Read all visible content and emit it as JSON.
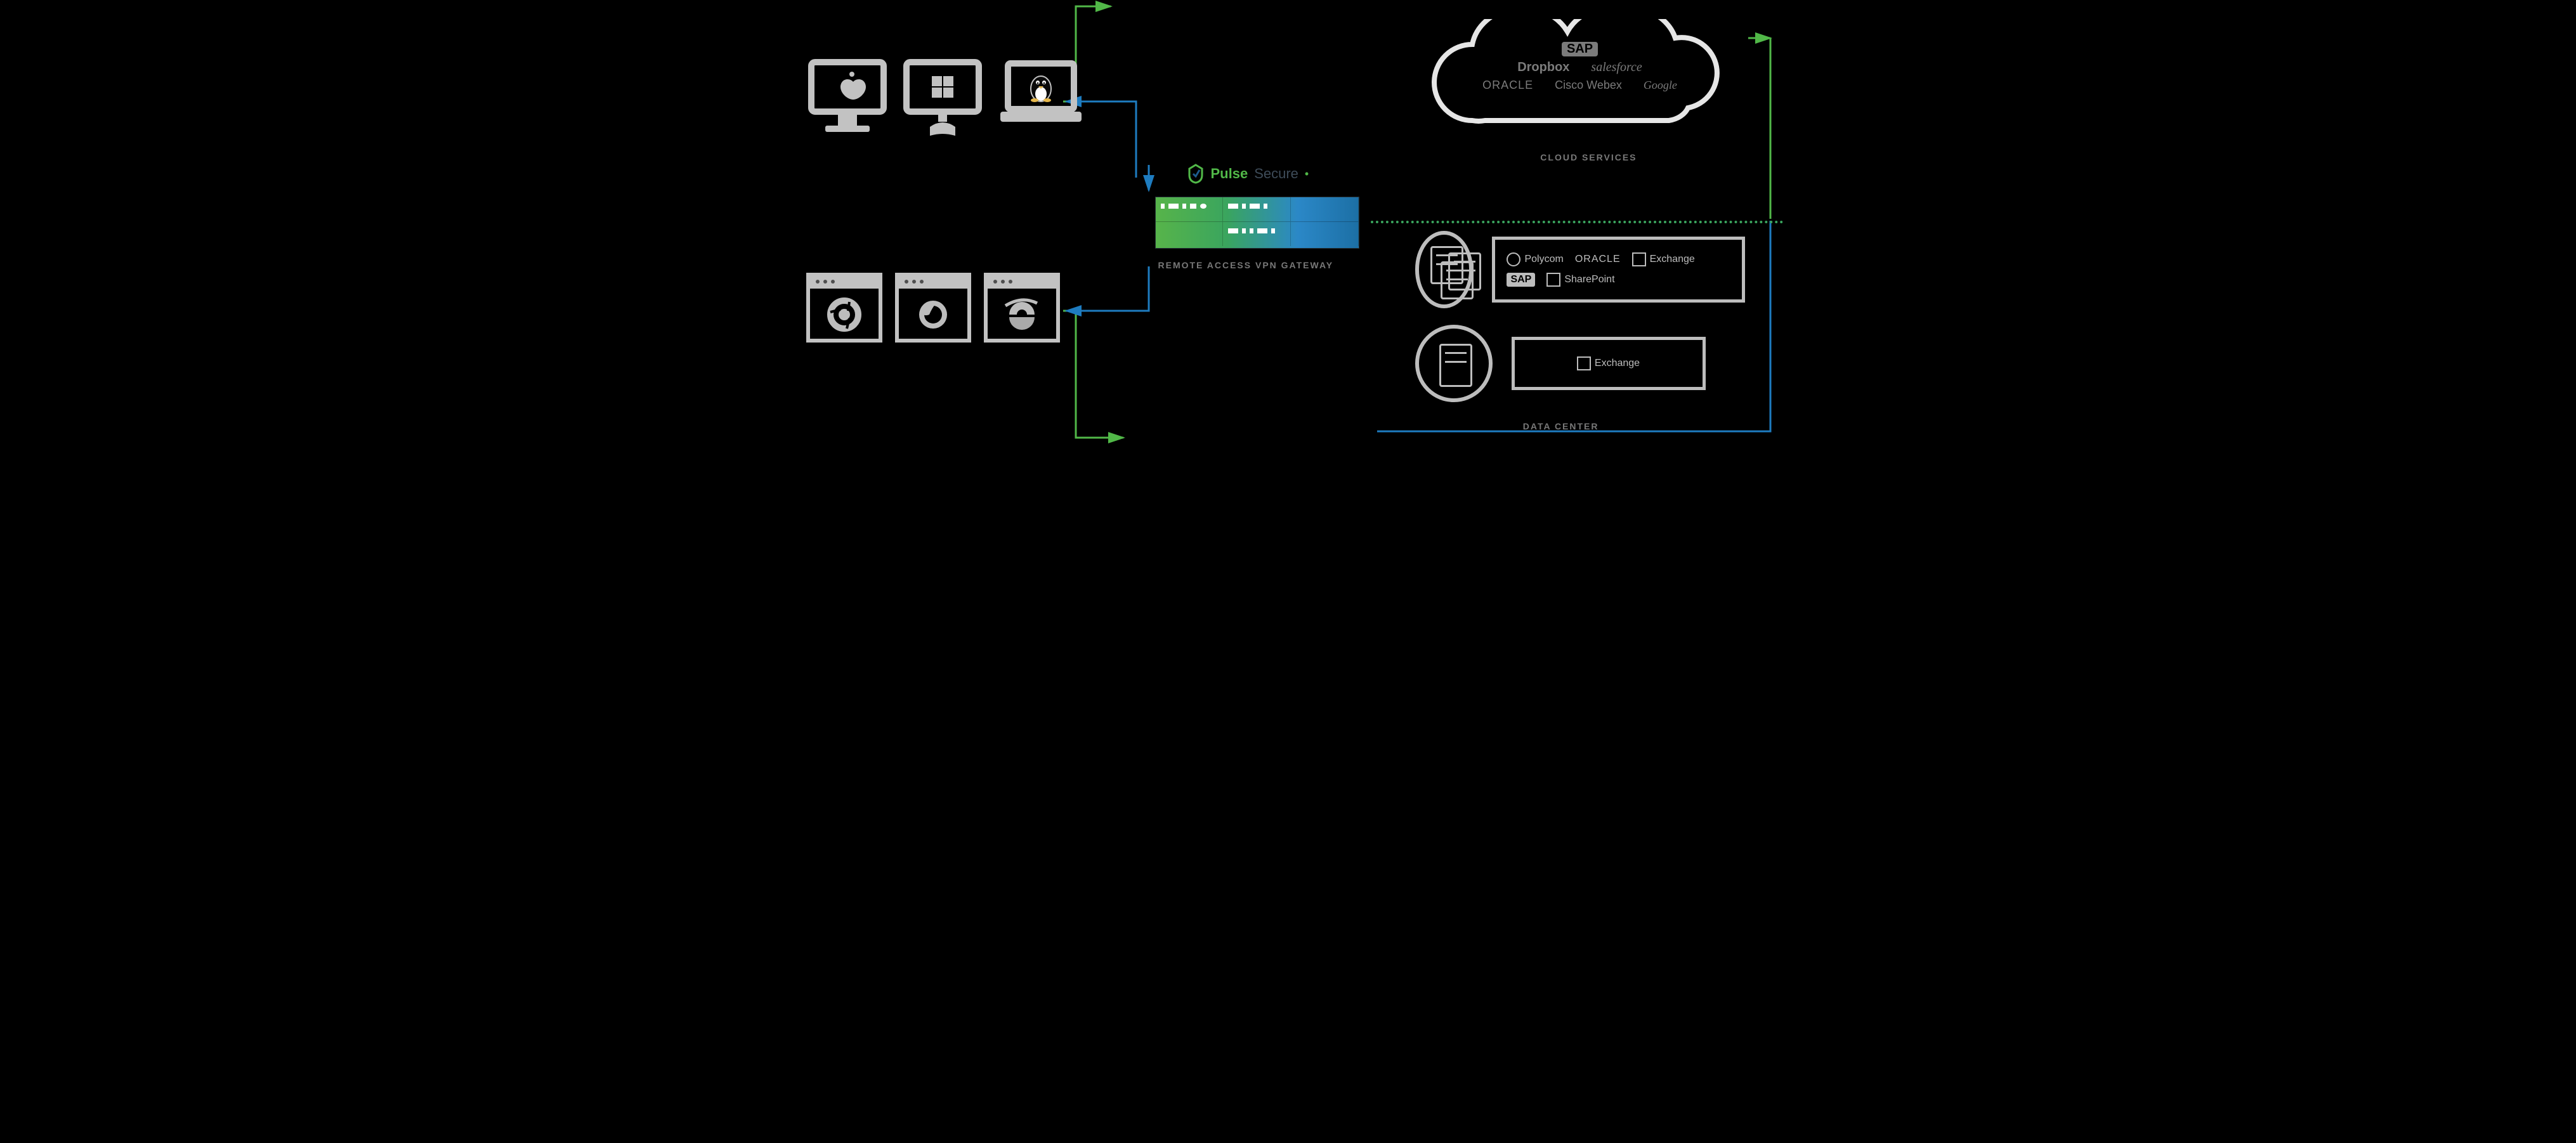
{
  "clients": {
    "os": [
      "apple",
      "windows",
      "linux"
    ],
    "browsers": [
      "chrome",
      "firefox",
      "ie"
    ]
  },
  "gateway": {
    "brand_primary": "Pulse",
    "brand_secondary": "Secure",
    "caption": "REMOTE ACCESS VPN GATEWAY"
  },
  "cloud": {
    "caption": "CLOUD SERVICES",
    "row1": [
      "SAP"
    ],
    "row2": [
      "Dropbox",
      "salesforce"
    ],
    "row3": [
      "ORACLE",
      "Cisco Webex",
      "Google"
    ]
  },
  "datacenter": {
    "caption": "DATA CENTER",
    "group1": [
      "Polycom",
      "ORACLE",
      "Exchange",
      "SAP",
      "SharePoint"
    ],
    "group2": [
      "Exchange"
    ]
  },
  "colors": {
    "green": "#51b848",
    "blue": "#1e7cc0",
    "gray": "#bdbdbd"
  }
}
